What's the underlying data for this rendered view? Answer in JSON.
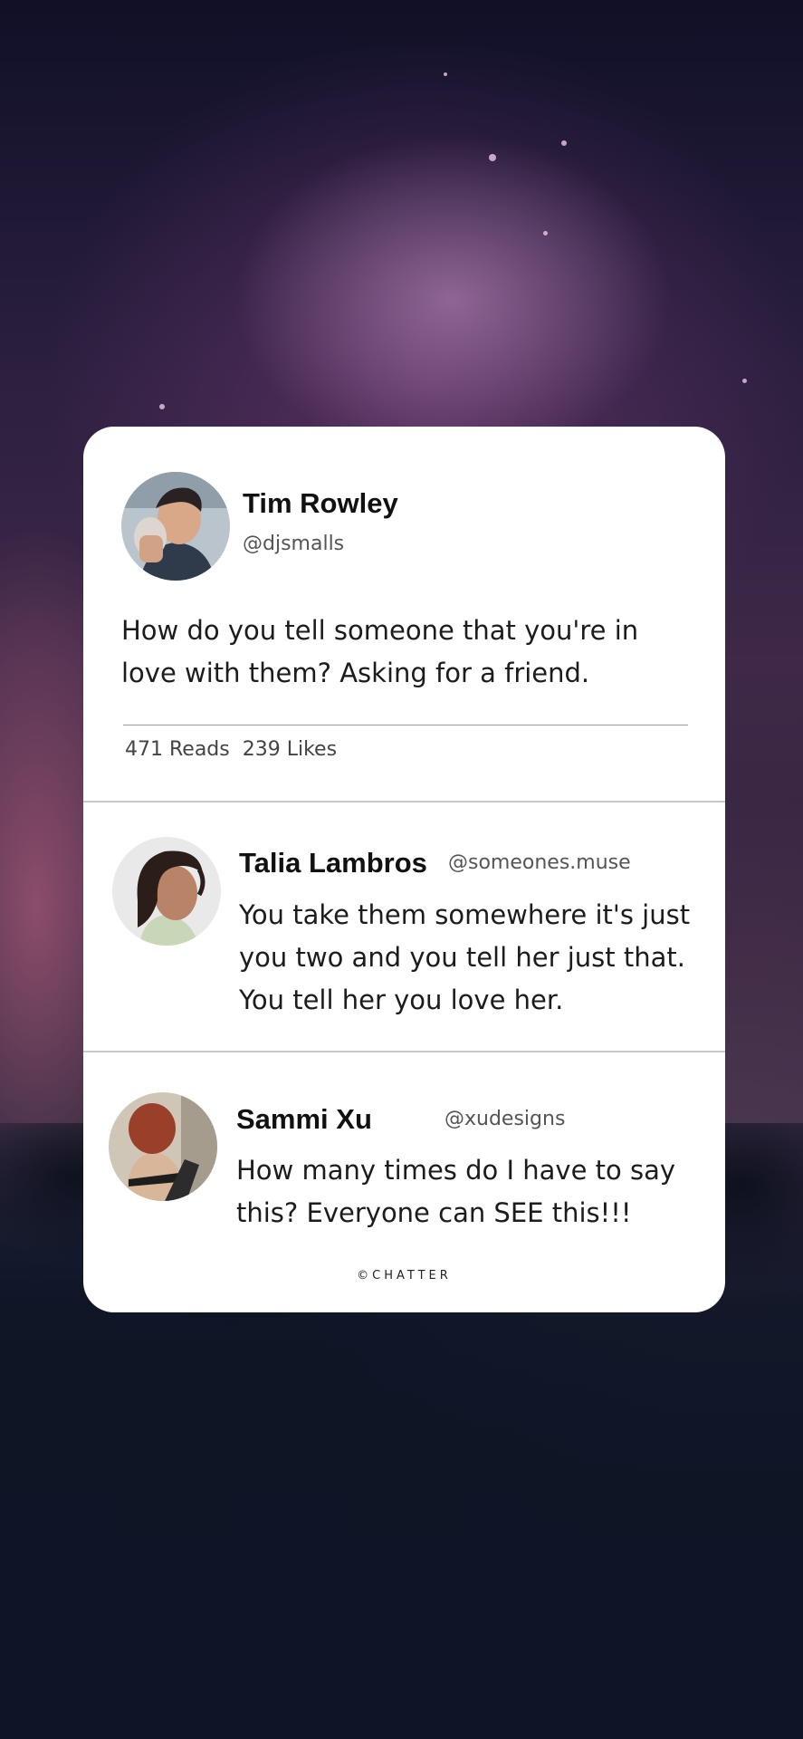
{
  "post": {
    "author_name": "Tim Rowley",
    "author_handle": "@djsmalls",
    "text": "How do you tell someone that you're in love with them? Asking for a friend.",
    "reads": "471 Reads",
    "likes": "239 Likes"
  },
  "replies": [
    {
      "author_name": "Talia Lambros",
      "author_handle": "@someones.muse",
      "text": "You take them somewhere it's just you two and you tell her just that. You tell her you love her."
    },
    {
      "author_name": "Sammi Xu",
      "author_handle": "@xudesigns",
      "text": "How many times do I have to say this? Everyone can SEE this!!!"
    }
  ],
  "footer": {
    "brand": "©CHATTER"
  },
  "colors": {
    "card_background": "#ffffff",
    "text_primary": "#111111",
    "text_secondary": "#555555",
    "divider": "#c9c9c9",
    "background_top": "#101027",
    "background_mid": "#3f2848",
    "background_bottom": "#121a2c"
  }
}
